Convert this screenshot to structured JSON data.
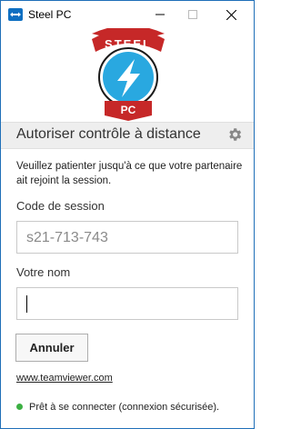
{
  "window": {
    "title": "Steel PC",
    "minimize_icon": "minimize-icon",
    "maximize_icon": "maximize-icon",
    "close_icon": "close-icon"
  },
  "logo": {
    "top_text": "STEEL",
    "bottom_text": "PC",
    "icon": "lightning-bolt-icon",
    "colors": {
      "ribbon": "#c62828",
      "circle": "#29a8e0"
    }
  },
  "section": {
    "title": "Autoriser contrôle à distance",
    "settings_icon": "gear-icon"
  },
  "info": "Veuillez patienter jusqu'à ce que votre partenaire ait rejoint la session.",
  "session": {
    "label": "Code de session",
    "value": "s21-713-743"
  },
  "name": {
    "label": "Votre nom",
    "value": ""
  },
  "buttons": {
    "cancel": "Annuler"
  },
  "link": "www.teamviewer.com",
  "status": {
    "text": "Prêt à se connecter (connexion sécurisée).",
    "color": "#3cb043"
  }
}
